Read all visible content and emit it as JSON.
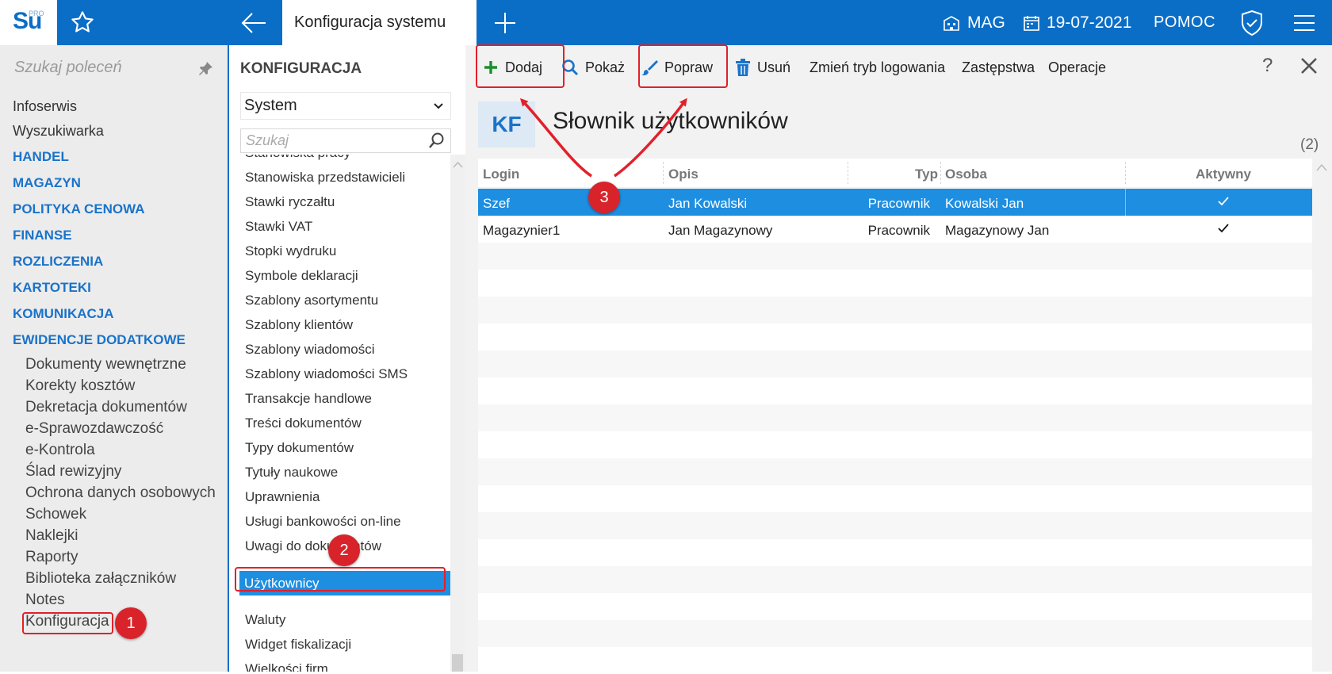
{
  "topbar": {
    "logo_main": "Su",
    "logo_pro": "PRO",
    "active_tab": "Konfiguracja systemu",
    "warehouse": "MAG",
    "date": "19-07-2021",
    "help": "POMOC"
  },
  "leftnav": {
    "search_placeholder": "Szukaj poleceń",
    "top_items": [
      "Infoserwis",
      "Wyszukiwarka"
    ],
    "sections": [
      "HANDEL",
      "MAGAZYN",
      "POLITYKA CENOWA",
      "FINANSE",
      "ROZLICZENIA",
      "KARTOTEKI",
      "KOMUNIKACJA",
      "EWIDENCJE DODATKOWE"
    ],
    "sub_items": [
      "Dokumenty wewnętrzne",
      "Korekty kosztów",
      "Dekretacja dokumentów",
      "e-Sprawozdawczość",
      "e-Kontrola",
      "Ślad rewizyjny",
      "Ochrona danych osobowych",
      "Schowek",
      "Naklejki",
      "Raporty",
      "Biblioteka załączników",
      "Notes",
      "Konfiguracja"
    ]
  },
  "midpanel": {
    "title": "KONFIGURACJA",
    "select_value": "System",
    "search_placeholder": "Szukaj",
    "items": [
      "Stanowiska pracy",
      "Stanowiska przedstawicieli",
      "Stawki ryczałtu",
      "Stawki VAT",
      "Stopki wydruku",
      "Symbole deklaracji",
      "Szablony asortymentu",
      "Szablony klientów",
      "Szablony wiadomości",
      "Szablony wiadomości SMS",
      "Transakcje handlowe",
      "Treści dokumentów",
      "Typy dokumentów",
      "Tytuły naukowe",
      "Uprawnienia",
      "Usługi bankowości on-line",
      "Uwagi do dokumentów",
      "Użytkownicy",
      "Waluty",
      "Widget fiskalizacji",
      "Wielkości firm"
    ],
    "selected": "Użytkownicy"
  },
  "toolbar": {
    "add": "Dodaj",
    "show": "Pokaż",
    "edit": "Popraw",
    "delete": "Usuń",
    "login_mode": "Zmień tryb logowania",
    "substitution": "Zastępstwa",
    "operations": "Operacje",
    "help": "?"
  },
  "main": {
    "badge": "KF",
    "title": "Słownik użytkowników",
    "count": "(2)",
    "columns": [
      "Login",
      "Opis",
      "Typ",
      "Osoba",
      "Aktywny"
    ],
    "rows": [
      {
        "login": "Szef",
        "opis": "Jan Kowalski",
        "typ": "Pracownik",
        "osoba": "Kowalski Jan",
        "aktywny": true
      },
      {
        "login": "Magazynier1",
        "opis": "Jan Magazynowy",
        "typ": "Pracownik",
        "osoba": "Magazynowy Jan",
        "aktywny": true
      }
    ]
  },
  "annotations": {
    "step1": "1",
    "step2": "2",
    "step3": "3"
  },
  "colors": {
    "brand": "#0a6ec7",
    "selection": "#1e8ee0",
    "annotation": "#d8232a"
  }
}
